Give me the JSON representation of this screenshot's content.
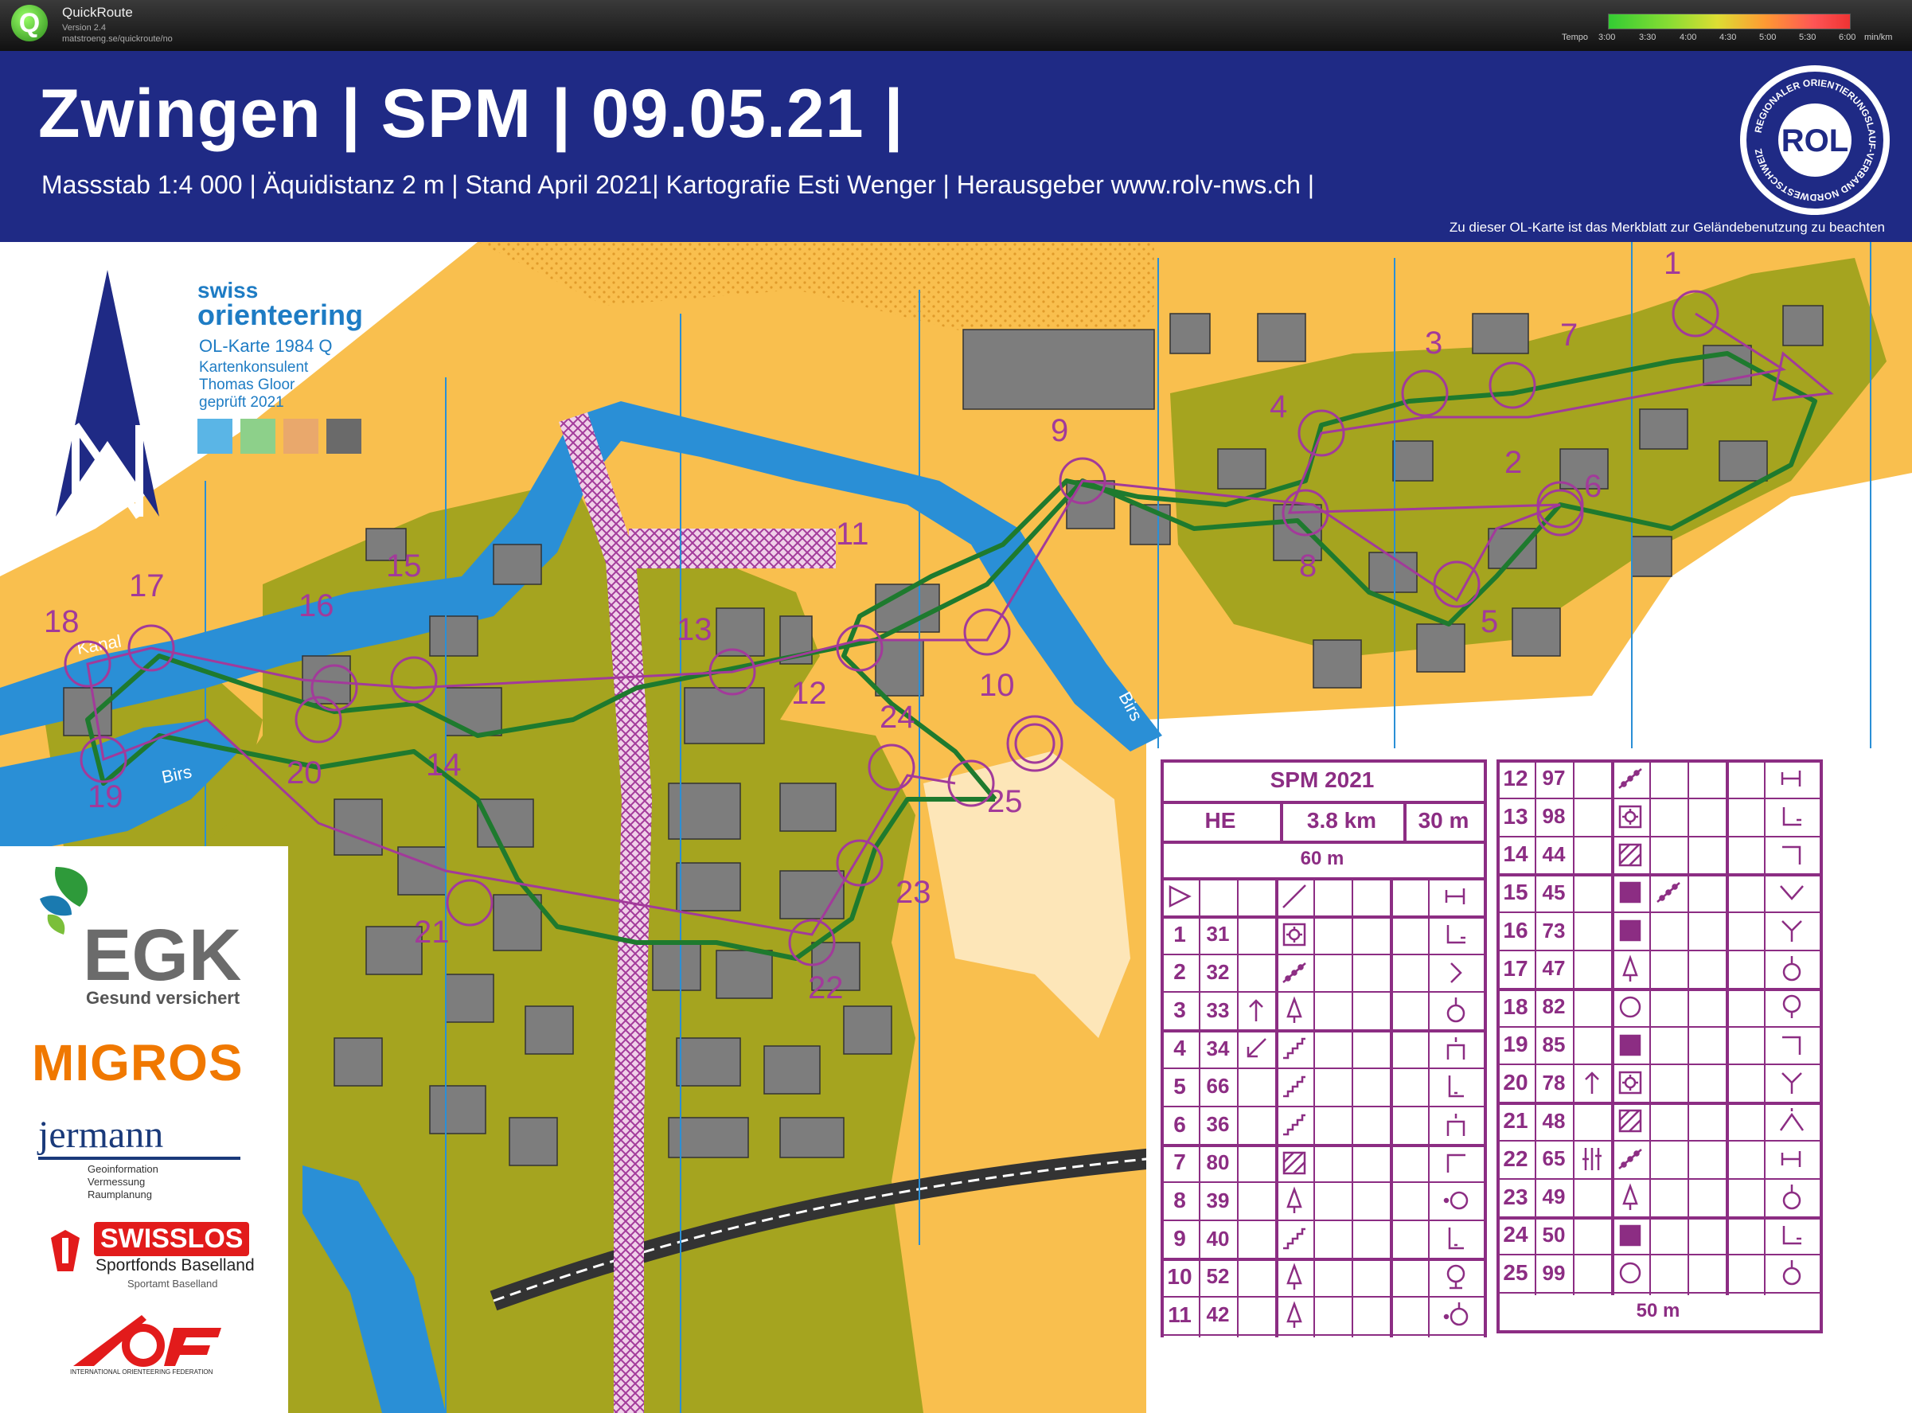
{
  "app": {
    "name": "QuickRoute",
    "version": "Version 2.4",
    "url": "matstroeng.se/quickroute/no",
    "tempo_label": "Tempo",
    "tempo_ticks": [
      "3:00",
      "3:30",
      "4:00",
      "4:30",
      "5:00",
      "5:30",
      "6:00"
    ],
    "tempo_unit": "min/km",
    "colors": {
      "bar_bg": "#111111",
      "tempo_start": "#33cc33",
      "tempo_end": "#ee3333"
    }
  },
  "header": {
    "title": "Zwingen | SPM | 09.05.21 |",
    "subtitle": "Massstab 1:4 000 | Äquidistanz 2 m | Stand April 2021| Kartografie Esti Wenger | Herausgeber www.rolv-nws.ch |",
    "notice": "Zu dieser OL-Karte ist das Merkblatt zur Geländebenutzung zu beachten",
    "logo_text": "ROL",
    "logo_ring_text": "REGIONALER ORIENTIERUNGSLAUF-VERBAND NORDWESTSCHWEIZ",
    "colors": {
      "background": "#1f2a85",
      "text": "#ffffff"
    }
  },
  "map": {
    "north_arrow_icon": "north-arrow-icon",
    "water_labels": [
      "Kanal",
      "Birs",
      "Birs"
    ],
    "colors": {
      "open_land": "#f9bf4e",
      "forest": "#a5a41f",
      "building": "#7d7d7d",
      "water": "#2a8fd6",
      "course": "#a23a9a",
      "route": "#1e7a2e",
      "grid": "#2a8fd6",
      "paved": "#f4d9ad"
    }
  },
  "swiss_orienteering": {
    "logo_line1": "swiss",
    "logo_line2": "orienteering",
    "map_type": "OL-Karte 1984 Q",
    "consultant_label": "Kartenkonsulent",
    "consultant": "Thomas Gloor",
    "checked": "geprüft 2021",
    "swatch_colors": [
      "#5ab5e6",
      "#8dd08a",
      "#e9a86c",
      "#6a6a6a"
    ]
  },
  "controls": {
    "labels": [
      "1",
      "2",
      "3",
      "4",
      "5",
      "6",
      "7",
      "8",
      "9",
      "10",
      "11",
      "12",
      "13",
      "14",
      "15",
      "16",
      "17",
      "18",
      "19",
      "20",
      "21",
      "22",
      "23",
      "24",
      "25"
    ]
  },
  "sponsors": {
    "egk": "EGK",
    "egk_tagline": "Gesund versichert",
    "migros": "MIGROS",
    "jermann": "jermann",
    "jermann_sub": "Geoinformation\nVermessung\nRaumplanung",
    "swisslos": "SWISSLOS",
    "swisslos_sub": "Sportfonds Baselland",
    "swisslos_sub2": "Sportamt Baselland",
    "iof_caption": "INTERNATIONAL ORIENTEERING FEDERATION",
    "colors": {
      "egk_green": "#2e9a3a",
      "egk_blue": "#1a7ab0",
      "migros": "#f07800",
      "jermann": "#1a3a7a",
      "swisslos": "#e21b1b",
      "iof": "#e21b1b"
    }
  },
  "control_descriptions": {
    "title": "SPM 2021",
    "class": "HE",
    "length": "3.8 km",
    "climb": "30 m",
    "start_distance": "60 m",
    "finish_distance": "50 m",
    "color": "#8c2d83",
    "rows": [
      {
        "num": "1",
        "code": "31",
        "c": "",
        "d": "rootstock-icon",
        "g": "",
        "h": "corner-south-east-icon"
      },
      {
        "num": "2",
        "code": "32",
        "c": "",
        "d": "hedge-icon",
        "g": "",
        "h": "east-side-icon"
      },
      {
        "num": "3",
        "code": "33",
        "c": "north-arrow-icon",
        "d": "tree-icon",
        "g": "",
        "h": "foot-icon"
      },
      {
        "num": "4",
        "code": "34",
        "c": "south-west-arrow-icon",
        "d": "stairway-icon",
        "g": "",
        "h": "top-icon"
      },
      {
        "num": "5",
        "code": "66",
        "c": "",
        "d": "stairway-icon",
        "g": "",
        "h": "lower-part-icon"
      },
      {
        "num": "6",
        "code": "36",
        "c": "",
        "d": "stairway-icon",
        "g": "",
        "h": "top-icon"
      },
      {
        "num": "7",
        "code": "80",
        "c": "",
        "d": "hatched-area-icon",
        "g": "",
        "h": "corner-north-west-icon"
      },
      {
        "num": "8",
        "code": "39",
        "c": "",
        "d": "tree-icon",
        "g": "",
        "h": "west-side-icon"
      },
      {
        "num": "9",
        "code": "40",
        "c": "",
        "d": "stairway-icon",
        "g": "",
        "h": "lower-part-icon"
      },
      {
        "num": "10",
        "code": "52",
        "c": "",
        "d": "tree-icon",
        "g": "",
        "h": "foot-top-icon"
      },
      {
        "num": "11",
        "code": "42",
        "c": "",
        "d": "tree-icon",
        "g": "",
        "h": "west-foot-icon"
      },
      {
        "num": "12",
        "code": "97",
        "c": "",
        "d": "hedge-icon",
        "g": "",
        "h": "end-icon"
      },
      {
        "num": "13",
        "code": "98",
        "c": "",
        "d": "rootstock-icon",
        "g": "",
        "h": "corner-south-east-icon"
      },
      {
        "num": "14",
        "code": "44",
        "c": "",
        "d": "hatched-area-icon",
        "g": "",
        "h": "corner-north-east-icon"
      },
      {
        "num": "15",
        "code": "45",
        "c": "",
        "d": "filled-square-icon",
        "e": "hedge-icon",
        "g": "",
        "h": "bend-icon"
      },
      {
        "num": "16",
        "code": "73",
        "c": "",
        "d": "filled-square-icon",
        "g": "",
        "h": "junction-icon"
      },
      {
        "num": "17",
        "code": "47",
        "c": "",
        "d": "tree-icon",
        "g": "",
        "h": "foot-icon"
      },
      {
        "num": "18",
        "code": "82",
        "c": "",
        "d": "circle-icon",
        "g": "",
        "h": "top-foot-icon"
      },
      {
        "num": "19",
        "code": "85",
        "c": "",
        "d": "filled-square-icon",
        "g": "",
        "h": "corner-north-east-icon"
      },
      {
        "num": "20",
        "code": "78",
        "c": "north-arrow-icon",
        "d": "rootstock-icon",
        "g": "",
        "h": "junction-icon"
      },
      {
        "num": "21",
        "code": "48",
        "c": "",
        "d": "hatched-area-icon",
        "g": "",
        "h": "upper-part-icon"
      },
      {
        "num": "22",
        "code": "65",
        "c": "pipeline-icon",
        "d": "hedge-icon",
        "g": "",
        "h": "end-icon"
      },
      {
        "num": "23",
        "code": "49",
        "c": "",
        "d": "tree-icon",
        "g": "",
        "h": "foot-icon"
      },
      {
        "num": "24",
        "code": "50",
        "c": "",
        "d": "filled-square-icon",
        "g": "",
        "h": "corner-south-east-icon"
      },
      {
        "num": "25",
        "code": "99",
        "c": "",
        "d": "circle-icon",
        "g": "",
        "h": "foot-icon"
      }
    ]
  }
}
